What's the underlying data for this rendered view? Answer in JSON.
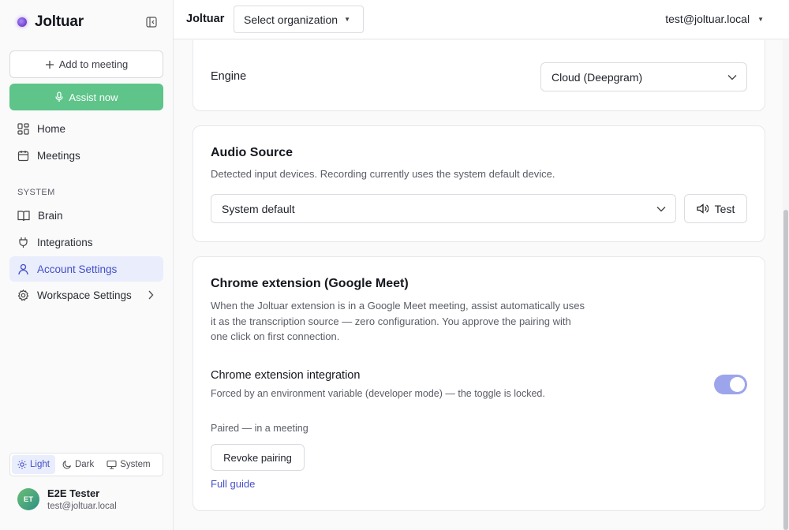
{
  "brand": {
    "name": "Joltuar"
  },
  "sidebar": {
    "add_to_meeting": "Add to meeting",
    "assist_now": "Assist now",
    "items": [
      {
        "label": "Home"
      },
      {
        "label": "Meetings"
      }
    ],
    "section_label": "SYSTEM",
    "system_items": [
      {
        "label": "Brain"
      },
      {
        "label": "Integrations"
      },
      {
        "label": "Account Settings"
      },
      {
        "label": "Workspace Settings"
      }
    ],
    "theme": {
      "light": "Light",
      "dark": "Dark",
      "system": "System",
      "selected": "Light"
    },
    "user": {
      "initials": "ET",
      "name": "E2E Tester",
      "email": "test@joltuar.local"
    }
  },
  "header": {
    "title": "Joltuar",
    "org_select": "Select organization",
    "user_email": "test@joltuar.local"
  },
  "engine_card": {
    "label": "Engine",
    "value": "Cloud (Deepgram)"
  },
  "audio_card": {
    "title": "Audio Source",
    "description": "Detected input devices. Recording currently uses the system default device.",
    "device": "System default",
    "test_label": "Test"
  },
  "chrome_card": {
    "title": "Chrome extension (Google Meet)",
    "description_lines": [
      "When the Joltuar extension is in a Google Meet meeting, assist automatically uses",
      "it as the transcription source — zero configuration. You approve the pairing with",
      "one click on first connection."
    ],
    "integration_title": "Chrome extension integration",
    "integration_desc": "Forced by an environment variable (developer mode) — the toggle is locked.",
    "toggle_on": true,
    "status": "Paired — in a meeting",
    "revoke_label": "Revoke pairing",
    "guide_link": "Full guide"
  },
  "colors": {
    "accent": "#4450c8",
    "assist_green": "#5ec48a",
    "toggle_locked": "#9ca5ec",
    "active_bg": "#e9edfc"
  }
}
